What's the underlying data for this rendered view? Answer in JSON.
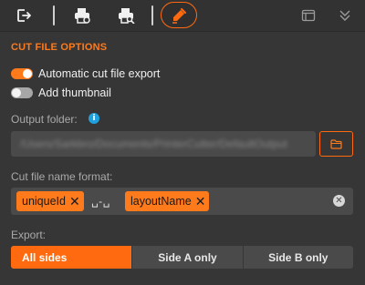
{
  "toolbar": {
    "icons": [
      "export-icon",
      "print-icon",
      "print-search-icon",
      "pen-icon",
      "window-icon",
      "chevron-double-down-icon"
    ],
    "accent": "#ff6a10"
  },
  "section": {
    "title": "CUT FILE OPTIONS"
  },
  "toggles": [
    {
      "label": "Automatic cut file export",
      "on": true
    },
    {
      "label": "Add thumbnail",
      "on": false
    }
  ],
  "output_folder": {
    "label": "Output folder:",
    "info": "i",
    "value": "/Users/Sarkbro/Documents/PrinterCutter/DefaultOutput"
  },
  "name_format": {
    "label": "Cut file name format:",
    "chips": [
      "uniqueId",
      "layoutName"
    ],
    "separator": "␣-␣",
    "clear": "✕",
    "remove": "✕"
  },
  "export": {
    "label": "Export:",
    "options": [
      "All sides",
      "Side A only",
      "Side B only"
    ],
    "selected": "All sides"
  }
}
